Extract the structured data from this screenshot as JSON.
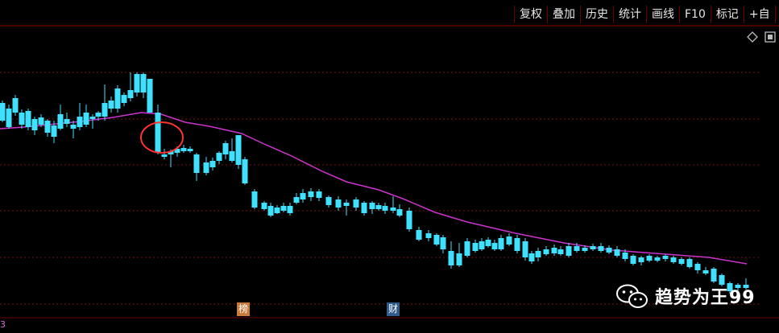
{
  "toolbar": {
    "buttons": [
      "复权",
      "叠加",
      "历史",
      "统计",
      "画线",
      "F10",
      "标记",
      "+自"
    ]
  },
  "markers": {
    "bang": "榜",
    "cai": "财"
  },
  "bottom_label": "3",
  "watermark": {
    "text": "趋势为王99"
  },
  "colors": {
    "background": "#000000",
    "up": "#ff3b3b",
    "down": "#40e0ff",
    "ma_line": "#cc33cc",
    "grid": "#7a1010",
    "highlight_circle": "#ff3333"
  },
  "icons": [
    "diamond-icon",
    "settings-square-icon",
    "wechat-icon"
  ]
}
